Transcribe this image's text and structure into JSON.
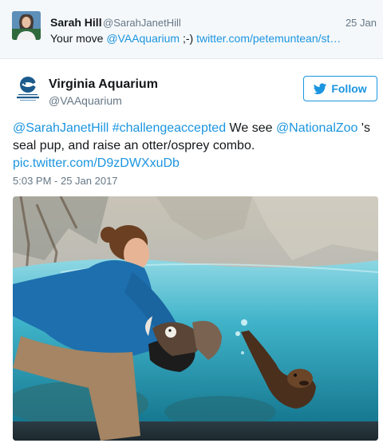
{
  "reply": {
    "name": "Sarah Hill",
    "handle": "@SarahJanetHill",
    "date": "25 Jan",
    "text_prefix": "Your move ",
    "mention": "@VAAquarium",
    "text_middle": " ;-) ",
    "link": "twitter.com/petemuntean/st…"
  },
  "tweet": {
    "author_name": "Virginia Aquarium",
    "author_handle": "@VAAquarium",
    "follow_label": "Follow",
    "mention_1": "@SarahJanetHill",
    "space_1": " ",
    "hashtag": "#challengeaccepted",
    "text_1": " We see ",
    "mention_2": "@NationalZoo",
    "text_2": " 's seal pup, and raise an otter/osprey combo.",
    "pic_link": "pic.twitter.com/D9zDWXxuDb",
    "timestamp": "5:03 PM - 25 Jan 2017"
  },
  "colors": {
    "link": "#1b95e0",
    "secondary_text": "#657786",
    "reply_background": "#f5f8fa"
  },
  "icons": {
    "follow": "twitter-bird-icon",
    "logo": "virginia-aquarium-logo"
  }
}
